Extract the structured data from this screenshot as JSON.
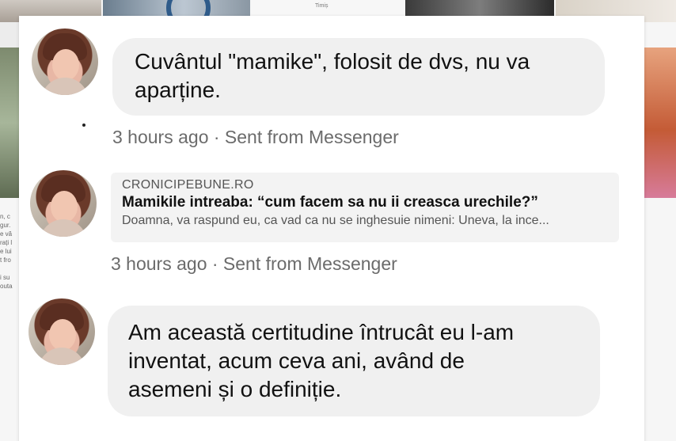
{
  "background": {
    "snippet_text": "Timiș",
    "left_column_text": [
      "n, c",
      "gur.",
      "e vă",
      "rați l",
      "e lui",
      "t fro",
      "",
      "i su",
      "outa"
    ]
  },
  "messages": [
    {
      "type": "text",
      "lines": [
        "Cuvântul \"mamike\", folosit de dvs, nu va",
        "aparține."
      ],
      "meta": "3 hours ago · Sent from Messenger"
    },
    {
      "type": "link",
      "domain": "CRONICIPEBUNE.RO",
      "title": "Mamikile intreaba: “cum facem sa nu ii creasca urechile?”",
      "description": "Doamna, va raspund eu, ca vad ca nu se inghesuie nimeni: Uneva, la ince...",
      "meta": "3 hours ago · Sent from Messenger"
    },
    {
      "type": "text",
      "lines": [
        "Am această certitudine întrucât eu l-am",
        "inventat, acum ceva ani,  având  de",
        "asemeni și o definiție."
      ]
    }
  ],
  "colors": {
    "bubble": "#f0f0f0",
    "meta_text": "#6b6b6b",
    "text": "#111111"
  }
}
